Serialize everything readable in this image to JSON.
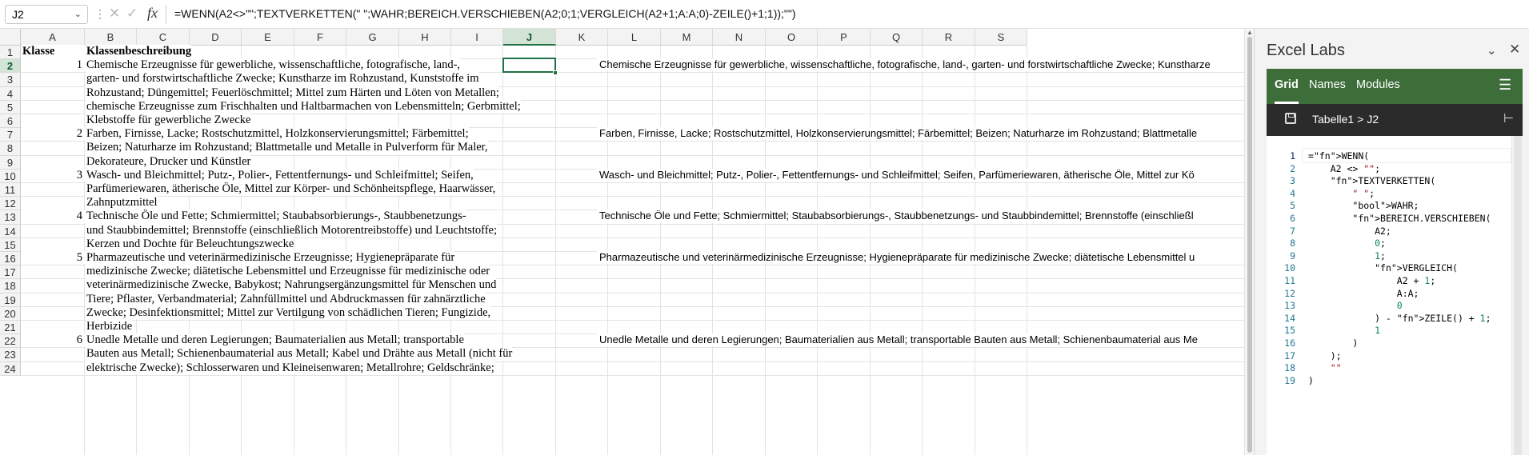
{
  "formula_bar": {
    "name_box": "J2",
    "fx_label": "fx",
    "formula": "=WENN(A2<>\"\";TEXTVERKETTEN(\" \";WAHR;BEREICH.VERSCHIEBEN(A2;0;1;VERGLEICH(A2+1;A:A;0)-ZEILE()+1;1));\"\")"
  },
  "columns": [
    "A",
    "B",
    "C",
    "D",
    "E",
    "F",
    "G",
    "H",
    "I",
    "J",
    "K",
    "L",
    "M",
    "N",
    "O",
    "P",
    "Q",
    "R",
    "S"
  ],
  "selected_column": "J",
  "selected_row": "2",
  "rows": [
    "1",
    "2",
    "3",
    "4",
    "5",
    "6",
    "7",
    "8",
    "9",
    "10",
    "11",
    "12",
    "13",
    "14",
    "15",
    "16",
    "17",
    "18",
    "19",
    "20",
    "21",
    "22",
    "23",
    "24"
  ],
  "sheet": {
    "header_a": "Klasse",
    "header_b": "Klassenbeschreibung",
    "col_a": [
      {
        "row": 2,
        "value": "1"
      },
      {
        "row": 7,
        "value": "2"
      },
      {
        "row": 10,
        "value": "3"
      },
      {
        "row": 13,
        "value": "4"
      },
      {
        "row": 16,
        "value": "5"
      },
      {
        "row": 22,
        "value": "6"
      }
    ],
    "col_b": [
      "Chemische Erzeugnisse für gewerbliche, wissenschaftliche, fotografische, land-,",
      "garten- und forstwirtschaftliche Zwecke; Kunstharze im Rohzustand, Kunststoffe im",
      "Rohzustand; Düngemittel; Feuerlöschmittel; Mittel zum Härten und Löten von Metallen;",
      "chemische Erzeugnisse zum Frischhalten und Haltbarmachen von Lebensmitteln; Gerbmittel;",
      "Klebstoffe für gewerbliche Zwecke",
      "Farben, Firnisse, Lacke; Rostschutzmittel, Holzkonservierungsmittel; Färbemittel;",
      "Beizen; Naturharze im Rohzustand; Blattmetalle und Metalle in Pulverform für Maler,",
      "Dekorateure, Drucker und Künstler",
      "Wasch- und Bleichmittel; Putz-, Polier-, Fettentfernungs- und Schleifmittel; Seifen,",
      "Parfümeriewaren, ätherische Öle, Mittel zur Körper- und Schönheitspflege, Haarwässer,",
      "Zahnputzmittel",
      "Technische Öle und Fette; Schmiermittel; Staubabsorbierungs-, Staubbenetzungs-",
      "und Staubbindemittel; Brennstoffe (einschließlich Motorentreibstoffe) und Leuchtstoffe;",
      "Kerzen und Dochte für Beleuchtungszwecke",
      "Pharmazeutische und veterinärmedizinische Erzeugnisse; Hygienepräparate für",
      "medizinische Zwecke; diätetische Lebensmittel und Erzeugnisse für medizinische oder",
      "veterinärmedizinische Zwecke, Babykost; Nahrungsergänzungsmittel für Menschen und",
      "Tiere; Pflaster, Verbandmaterial; Zahnfüllmittel und Abdruckmassen für zahnärztliche",
      "Zwecke; Desinfektionsmittel; Mittel zur Vertilgung von schädlichen Tieren; Fungizide,",
      "Herbizide",
      "Unedle Metalle und deren Legierungen; Baumaterialien aus Metall; transportable",
      "Bauten aus Metall; Schienenbaumaterial aus Metall; Kabel und Drähte aus Metall (nicht für",
      "elektrische Zwecke); Schlosserwaren und Kleineisenwaren; Metallrohre; Geldschränke;"
    ],
    "col_j": [
      {
        "row": 2,
        "value": "Chemische Erzeugnisse für gewerbliche, wissenschaftliche, fotografische, land-, garten- und forstwirtschaftliche Zwecke; Kunstharze"
      },
      {
        "row": 7,
        "value": "Farben, Firnisse, Lacke; Rostschutzmittel, Holzkonservierungsmittel; Färbemittel; Beizen; Naturharze im Rohzustand; Blattmetalle"
      },
      {
        "row": 10,
        "value": "Wasch- und Bleichmittel; Putz-, Polier-, Fettentfernungs- und Schleifmittel; Seifen, Parfümeriewaren, ätherische Öle, Mittel zur Kö"
      },
      {
        "row": 13,
        "value": "Technische Öle und Fette; Schmiermittel; Staubabsorbierungs-, Staubbenetzungs- und Staubbindemittel; Brennstoffe (einschließl"
      },
      {
        "row": 16,
        "value": "Pharmazeutische und veterinärmedizinische Erzeugnisse; Hygienepräparate für medizinische Zwecke; diätetische Lebensmittel u"
      },
      {
        "row": 22,
        "value": "Unedle Metalle und deren Legierungen; Baumaterialien aus Metall; transportable Bauten aus Metall; Schienenbaumaterial aus Me"
      }
    ]
  },
  "pane": {
    "title": "Excel Labs",
    "tabs": [
      "Grid",
      "Names",
      "Modules"
    ],
    "active_tab": "Grid",
    "breadcrumb_sheet": "Tabelle1",
    "breadcrumb_sep": ">",
    "breadcrumb_cell": "J2",
    "code_lines": [
      "=WENN(",
      "    A2 <> \"\";",
      "    TEXTVERKETTEN(",
      "        \" \";",
      "        WAHR;",
      "        BEREICH.VERSCHIEBEN(",
      "            A2;",
      "            0;",
      "            1;",
      "            VERGLEICH(",
      "                A2 + 1;",
      "                A:A;",
      "                0",
      "            ) - ZEILE() + 1;",
      "            1",
      "        )",
      "    );",
      "    \"\"",
      ")"
    ],
    "line_numbers": [
      "1",
      "2",
      "3",
      "4",
      "5",
      "6",
      "7",
      "8",
      "9",
      "10",
      "11",
      "12",
      "13",
      "14",
      "15",
      "16",
      "17",
      "18",
      "19"
    ]
  },
  "colors": {
    "excel_green": "#217346",
    "tab_bar": "#3d6e3a",
    "breadcrumb_bar": "#2b2b2b"
  }
}
